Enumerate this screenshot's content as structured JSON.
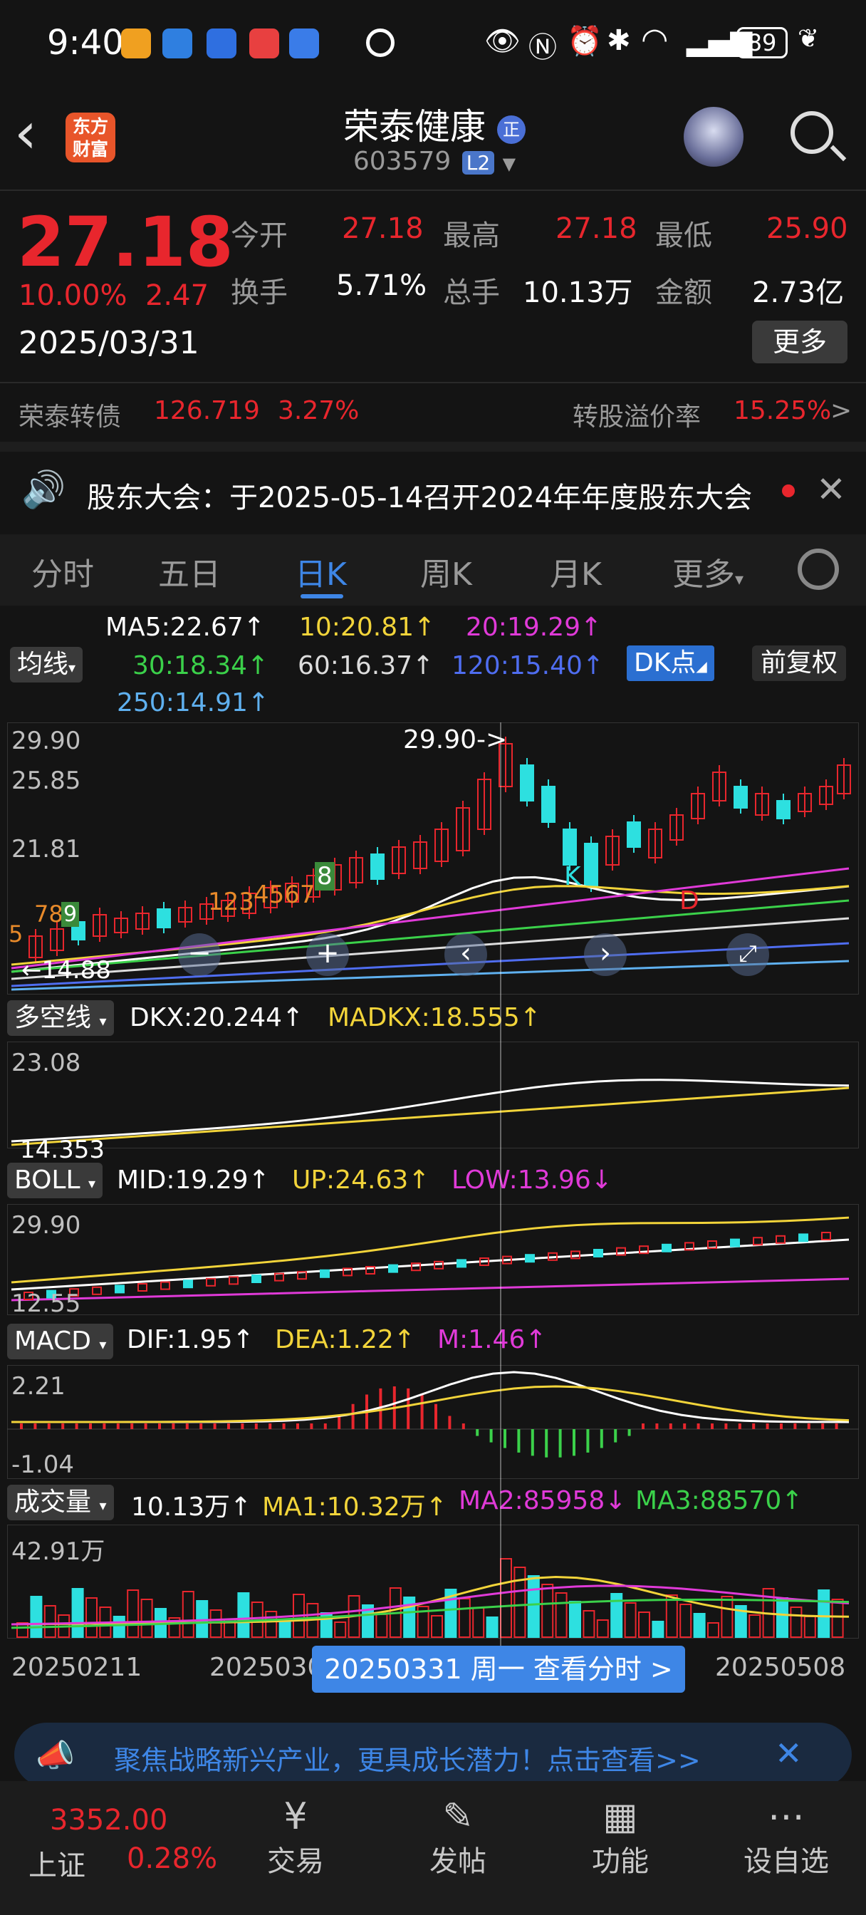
{
  "status_bar": {
    "time": "9:40",
    "battery": "89"
  },
  "header": {
    "logo_line1": "东方",
    "logo_line2": "财富",
    "stock_name": "荣泰健康",
    "badge": "正",
    "stock_code": "603579",
    "level": "L2"
  },
  "quote": {
    "price": "27.18",
    "change_pct": "10.00%",
    "change": "2.47",
    "date": "2025/03/31",
    "open_label": "今开",
    "open": "27.18",
    "high_label": "最高",
    "high": "27.18",
    "low_label": "最低",
    "low": "25.90",
    "turnover_label": "换手",
    "turnover": "5.71%",
    "volume_label": "总手",
    "volume": "10.13万",
    "amount_label": "金额",
    "amount": "2.73亿",
    "more_label": "更多"
  },
  "convertible": {
    "name": "荣泰转债",
    "price": "126.719",
    "pct": "3.27%",
    "premium_label": "转股溢价率",
    "premium": "15.25%",
    "arrow": ">"
  },
  "notice": {
    "text": "股东大会：于2025-05-14召开2024年年度股东大会"
  },
  "tabs": [
    {
      "label": "分时"
    },
    {
      "label": "五日"
    },
    {
      "label": "日K"
    },
    {
      "label": "周K"
    },
    {
      "label": "月K"
    },
    {
      "label": "更多"
    }
  ],
  "kline": {
    "ma_select": "均线",
    "ma5": "MA5:22.67↑",
    "ma10": "10:20.81↑",
    "ma20": "20:19.29↑",
    "ma30": "30:18.34↑",
    "ma60": "60:16.37↑",
    "ma120": "120:15.40↑",
    "ma250": "250:14.91↑",
    "dk_button": "DK点",
    "adjust_button": "前复权",
    "y_max": "29.90",
    "y_2": "25.85",
    "y_3": "21.81",
    "low_label": "14.88",
    "high_marker": "29.90->",
    "seq_1": "123",
    "seq_2": "4567",
    "seq_3": "8",
    "seq_4": "9",
    "seq_left_1": "5",
    "seq_left_2": "78",
    "seq_left_3": "9",
    "k_mark": "K",
    "d_mark": "D"
  },
  "dkx": {
    "select": "多空线",
    "dkx": "DKX:20.244↑",
    "madkx": "MADKX:18.555↑",
    "y_top": "23.08",
    "y_bottom": "14.353"
  },
  "boll": {
    "select": "BOLL",
    "mid": "MID:19.29↑",
    "up": "UP:24.63↑",
    "low": "LOW:13.96↓",
    "y_top": "29.90",
    "y_bottom": "12.55"
  },
  "macd": {
    "select": "MACD",
    "dif": "DIF:1.95↑",
    "dea": "DEA:1.22↑",
    "m": "M:1.46↑",
    "y_top": "2.21",
    "y_bottom": "-1.04"
  },
  "volume": {
    "select": "成交量",
    "vol": "10.13万↑",
    "ma1": "MA1:10.32万↑",
    "ma2": "MA2:85958↓",
    "ma3": "MA3:88570↑",
    "y_top": "42.91万"
  },
  "xaxis": {
    "start": "20250211",
    "mid": "2025030",
    "end": "20250508",
    "tooltip": "20250331 周一 查看分时 >"
  },
  "banner": {
    "text": "聚焦战略新兴产业，更具成长潜力！点击查看>>"
  },
  "bottom_nav": {
    "index_price": "3352.00",
    "index_name": "上证",
    "index_pct": "0.28%",
    "trade": "交易",
    "post": "发帖",
    "func": "功能",
    "watch": "设自选"
  },
  "colors": {
    "up": "#e8262d",
    "down": "#2de0e0",
    "accent": "#3e86e6",
    "background": "#141414"
  }
}
